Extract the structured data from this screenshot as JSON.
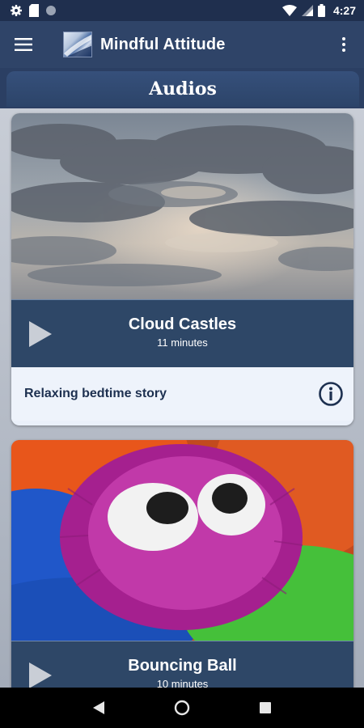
{
  "status_bar": {
    "time": "4:27",
    "icons": [
      "gear-icon",
      "sd-card-icon",
      "circle-icon",
      "wifi-icon",
      "signal-icon",
      "battery-icon"
    ]
  },
  "app_bar": {
    "title": "Mindful Attitude",
    "menu_icon": "hamburger-menu-icon",
    "overflow_icon": "more-vert-icon"
  },
  "section": {
    "title": "Audios"
  },
  "cards": [
    {
      "title": "Cloud Castles",
      "duration": "11 minutes",
      "description": "Relaxing bedtime story",
      "image": "cloudy-sky"
    },
    {
      "title": "Bouncing Ball",
      "duration": "10 minutes",
      "image": "fuzzy-ball-creature"
    }
  ],
  "colors": {
    "primary": "#2f4468",
    "card_bar": "#2e4767",
    "card_footer": "#eef3fb",
    "accent_text": "#1d3050"
  },
  "nav_bar": {
    "icons": [
      "back-icon",
      "home-icon",
      "recents-icon"
    ]
  }
}
